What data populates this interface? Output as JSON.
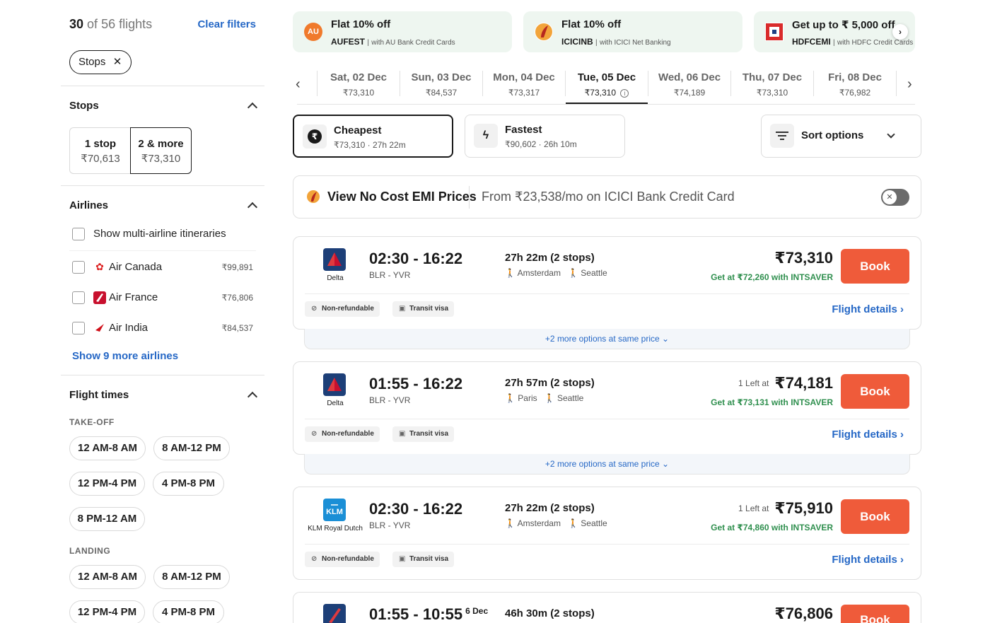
{
  "sidebar": {
    "count_shown": "30",
    "count_of": "of",
    "count_total": "56 flights",
    "clear_filters": "Clear filters",
    "active_chip": "Stops",
    "stops_title": "Stops",
    "stops": [
      {
        "label": "1 stop",
        "price": "₹70,613",
        "selected": false
      },
      {
        "label": "2 & more",
        "price": "₹73,310",
        "selected": true
      }
    ],
    "airlines_title": "Airlines",
    "multi_airline": "Show multi-airline itineraries",
    "airlines": [
      {
        "name": "Air Canada",
        "price": "₹99,891"
      },
      {
        "name": "Air France",
        "price": "₹76,806"
      },
      {
        "name": "Air India",
        "price": "₹84,537"
      }
    ],
    "show_more_airlines": "Show 9 more airlines",
    "flight_times_title": "Flight times",
    "takeoff_label": "TAKE-OFF",
    "takeoff_slots": [
      "12 AM-8 AM",
      "8 AM-12 PM",
      "12 PM-4 PM",
      "4 PM-8 PM",
      "8 PM-12 AM"
    ],
    "landing_label": "LANDING",
    "landing_slots": [
      "12 AM-8 AM",
      "8 AM-12 PM",
      "12 PM-4 PM",
      "4 PM-8 PM"
    ]
  },
  "offers": [
    {
      "title": "Flat 10% off",
      "code": "AUFEST",
      "desc": "with AU Bank Credit Cards",
      "icon": "AU",
      "color": "#f07a2c"
    },
    {
      "title": "Flat 10% off",
      "code": "ICICINB",
      "desc": "with ICICI Net Banking",
      "icon": "icici-icon",
      "color": "#b6281f"
    },
    {
      "title": "Get up to ₹ 5,000 off",
      "code": "HDFCEMI",
      "desc": "with HDFC Credit Cards",
      "icon": "hdfc-icon",
      "color": "#d92b2b"
    }
  ],
  "dates": [
    {
      "day": "Sat, 02 Dec",
      "price": "₹73,310",
      "selected": false
    },
    {
      "day": "Sun, 03 Dec",
      "price": "₹84,537",
      "selected": false
    },
    {
      "day": "Mon, 04 Dec",
      "price": "₹73,317",
      "selected": false
    },
    {
      "day": "Tue, 05 Dec",
      "price": "₹73,310",
      "selected": true
    },
    {
      "day": "Wed, 06 Dec",
      "price": "₹74,189",
      "selected": false
    },
    {
      "day": "Thu, 07 Dec",
      "price": "₹73,310",
      "selected": false
    },
    {
      "day": "Fri, 08 Dec",
      "price": "₹76,982",
      "selected": false
    }
  ],
  "sort": {
    "cheapest": {
      "title": "Cheapest",
      "price": "₹73,310",
      "dur": "27h 22m"
    },
    "fastest": {
      "title": "Fastest",
      "price": "₹90,602",
      "dur": "26h 10m"
    },
    "options_label": "Sort options"
  },
  "emi": {
    "title": "View No Cost EMI Prices",
    "text": "From ₹23,538/mo on ICICI Bank Credit Card"
  },
  "flights": [
    {
      "airline": "Delta",
      "logo_color": "#1d3f78",
      "dep": "02:30",
      "arr": "16:22",
      "next_day": "",
      "route": "BLR - YVR",
      "duration": "27h 22m (2 stops)",
      "via1": "Amsterdam",
      "via2": "Seattle",
      "seats_left": "",
      "price": "₹73,310",
      "intsaver": "Get at ₹72,260 with INTSAVER",
      "book": "Book",
      "tag1": "Non-refundable",
      "tag2": "Transit visa",
      "details": "Flight details",
      "more_options": "+2 more options at same price"
    },
    {
      "airline": "Delta",
      "logo_color": "#1d3f78",
      "dep": "01:55",
      "arr": "16:22",
      "next_day": "",
      "route": "BLR - YVR",
      "duration": "27h 57m (2 stops)",
      "via1": "Paris",
      "via2": "Seattle",
      "seats_left": "1 Left at",
      "price": "₹74,181",
      "intsaver": "Get at ₹73,131 with INTSAVER",
      "book": "Book",
      "tag1": "Non-refundable",
      "tag2": "Transit visa",
      "details": "Flight details",
      "more_options": "+2 more options at same price"
    },
    {
      "airline": "KLM Royal Dutch",
      "logo_color": "#1b8fd6",
      "dep": "02:30",
      "arr": "16:22",
      "next_day": "",
      "route": "BLR - YVR",
      "duration": "27h 22m (2 stops)",
      "via1": "Amsterdam",
      "via2": "Seattle",
      "seats_left": "1 Left at",
      "price": "₹75,910",
      "intsaver": "Get at ₹74,860 with INTSAVER",
      "book": "Book",
      "tag1": "Non-refundable",
      "tag2": "Transit visa",
      "details": "Flight details",
      "more_options": ""
    },
    {
      "airline": "",
      "logo_color": "#1d3f78",
      "dep": "01:55",
      "arr": "10:55",
      "next_day": "6 Dec",
      "route": "",
      "duration": "46h 30m (2 stops)",
      "via1": "",
      "via2": "",
      "seats_left": "",
      "price": "₹76,806",
      "intsaver": "",
      "book": "Book",
      "tag1": "",
      "tag2": "",
      "details": "",
      "more_options": ""
    }
  ]
}
